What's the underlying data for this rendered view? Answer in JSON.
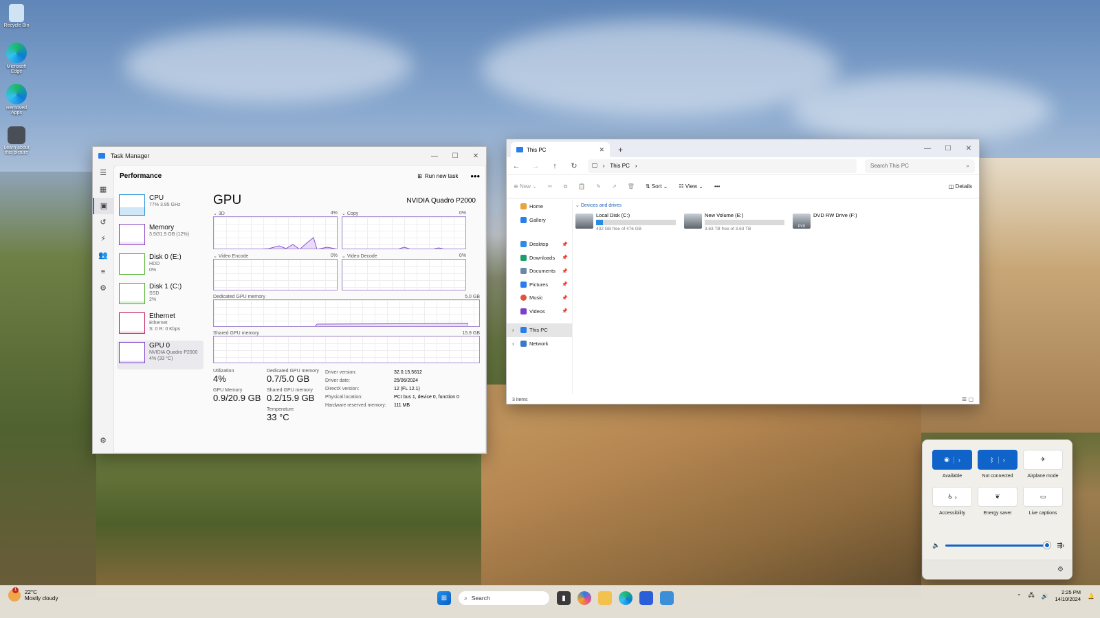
{
  "desktop": {
    "icons": [
      {
        "label": "Recycle Bin",
        "icon": "recycle-bin-icon"
      },
      {
        "label": "Microsoft Edge",
        "icon": "edge-icon"
      },
      {
        "label": "Removed Apps",
        "icon": "edge-icon"
      },
      {
        "label": "Learn about this picture",
        "icon": "camera-icon"
      }
    ]
  },
  "task_manager": {
    "window_title": "Task Manager",
    "page_title": "Performance",
    "run_new_task": "Run new task",
    "more": "•••",
    "list": [
      {
        "name": "CPU",
        "sub1": "77% 3.95 GHz",
        "sub2": "",
        "color": "#1e90d6"
      },
      {
        "name": "Memory",
        "sub1": "3.9/31.9 GB (12%)",
        "sub2": "",
        "color": "#8a3fbf"
      },
      {
        "name": "Disk 0 (E:)",
        "sub1": "HDD",
        "sub2": "0%",
        "color": "#4caf2a"
      },
      {
        "name": "Disk 1 (C:)",
        "sub1": "SSD",
        "sub2": "2%",
        "color": "#4caf2a"
      },
      {
        "name": "Ethernet",
        "sub1": "Ethernet",
        "sub2": "S: 0 R: 0 Kbps",
        "color": "#c2185b"
      },
      {
        "name": "GPU 0",
        "sub1": "NVIDIA Quadro P2000",
        "sub2": "4% (33 °C)",
        "color": "#7b3fc7"
      }
    ],
    "gpu": {
      "title": "GPU",
      "name": "NVIDIA Quadro P2000",
      "graphs": {
        "g3d": {
          "label": "3D",
          "pct": "4%"
        },
        "copy": {
          "label": "Copy",
          "pct": "0%"
        },
        "encode": {
          "label": "Video Encode",
          "pct": "0%"
        },
        "decode": {
          "label": "Video Decode",
          "pct": "0%"
        },
        "dedicated": {
          "label": "Dedicated GPU memory",
          "max": "5.0 GB"
        },
        "shared": {
          "label": "Shared GPU memory",
          "max": "15.9 GB"
        }
      },
      "stats": {
        "utilization_label": "Utilization",
        "utilization": "4%",
        "ded_label": "Dedicated GPU memory",
        "ded": "0.7/5.0 GB",
        "gpumem_label": "GPU Memory",
        "gpumem": "0.9/20.9 GB",
        "shared_label": "Shared GPU memory",
        "shared": "0.2/15.9 GB",
        "temp_label": "Temperature",
        "temp": "33 °C"
      },
      "info": [
        {
          "k": "Driver version:",
          "v": "32.0.15.5612"
        },
        {
          "k": "Driver date:",
          "v": "25/06/2024"
        },
        {
          "k": "DirectX version:",
          "v": "12 (FL 12.1)"
        },
        {
          "k": "Physical location:",
          "v": "PCI bus 1, device 0, function 0"
        },
        {
          "k": "Hardware reserved memory:",
          "v": "111 MB"
        }
      ]
    }
  },
  "explorer": {
    "tab_title": "This PC",
    "breadcrumb": "This PC",
    "search_placeholder": "Search This PC",
    "cmd": {
      "new": "New",
      "sort": "Sort",
      "view": "View",
      "details": "Details"
    },
    "nav": {
      "home": "Home",
      "gallery": "Gallery",
      "pinned": [
        "Desktop",
        "Downloads",
        "Documents",
        "Pictures",
        "Music",
        "Videos"
      ],
      "this_pc": "This PC",
      "network": "Network"
    },
    "group_header": "Devices and drives",
    "drives": [
      {
        "name": "Local Disk (C:)",
        "free": "432 GB free of 476 GB",
        "used_pct": 9
      },
      {
        "name": "New Volume (E:)",
        "free": "3.63 TB free of 3.63 TB",
        "used_pct": 0
      },
      {
        "name": "DVD RW Drive (F:)",
        "free": "",
        "used_pct": null
      }
    ],
    "dvd_label": "DVD",
    "status": "3 items"
  },
  "quick_settings": {
    "tiles": [
      {
        "label": "Available",
        "icon": "wifi-icon",
        "on": true
      },
      {
        "label": "Not connected",
        "icon": "bluetooth-icon",
        "on": true
      },
      {
        "label": "Airplane mode",
        "icon": "airplane-icon",
        "on": false
      },
      {
        "label": "Accessibility",
        "icon": "accessibility-icon",
        "on": false
      },
      {
        "label": "Energy saver",
        "icon": "energy-saver-icon",
        "on": false
      },
      {
        "label": "Live captions",
        "icon": "captions-icon",
        "on": false
      }
    ],
    "volume_pct": 96
  },
  "taskbar": {
    "weather_temp": "22°C",
    "weather_desc": "Mostly cloudy",
    "weather_badge": "1",
    "search": "Search",
    "time": "2:25 PM",
    "date": "14/10/2024"
  }
}
